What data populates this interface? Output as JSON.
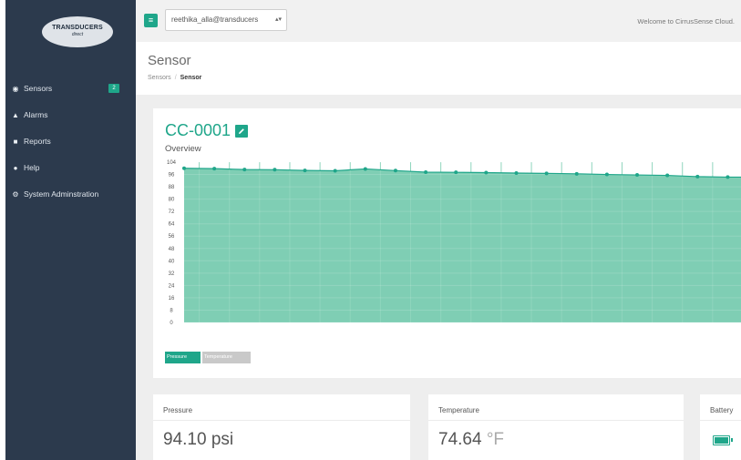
{
  "sidebar": {
    "logo": {
      "brand": "TRANSDUCERS",
      "sub": "direct"
    },
    "items": [
      {
        "label": "Sensors",
        "icon": "sensors-icon",
        "glyph": "◉",
        "badge": "2"
      },
      {
        "label": "Alarms",
        "icon": "bell-icon",
        "glyph": "▲"
      },
      {
        "label": "Reports",
        "icon": "file-icon",
        "glyph": "■"
      },
      {
        "label": "Help",
        "icon": "help-icon",
        "glyph": "●"
      },
      {
        "label": "System Adminstration",
        "icon": "gear-icon",
        "glyph": "⚙"
      }
    ]
  },
  "topbar": {
    "menu_icon": "≡",
    "account": "reethika_alla@transducers",
    "welcome": "Welcome to CirrusSense Cloud."
  },
  "page": {
    "title": "Sensor",
    "breadcrumb": {
      "parent": "Sensors",
      "separator": "/",
      "current": "Sensor"
    }
  },
  "sensor": {
    "id": "CC-0001"
  },
  "chart": {
    "overview_label": "Overview",
    "legend": {
      "pressure": "Pressure",
      "temperature": "Temperature"
    }
  },
  "chart_data": {
    "type": "area",
    "title": "Overview",
    "series": [
      {
        "name": "Pressure",
        "values": [
          100,
          99.8,
          99.2,
          99.1,
          98.6,
          98.4,
          99.6,
          98.5,
          97.5,
          97.4,
          97.2,
          96.9,
          96.7,
          96.4,
          96.0,
          95.7,
          95.4,
          94.6,
          94.3
        ]
      }
    ],
    "ylim": [
      0,
      104
    ],
    "yticks": [
      0,
      8,
      16,
      24,
      32,
      40,
      48,
      56,
      64,
      72,
      80,
      88,
      96,
      104
    ],
    "grid": true,
    "colors": {
      "fill": "#7fceb4",
      "line": "#1fa68a"
    }
  },
  "cards": {
    "pressure": {
      "title": "Pressure",
      "value": "94.10",
      "unit": "psi"
    },
    "temperature": {
      "title": "Temperature",
      "value": "74.64",
      "unit": "°F"
    },
    "battery": {
      "title": "Battery"
    }
  },
  "colors": {
    "accent": "#1fa68a",
    "sidebar": "#2c3a4d"
  }
}
